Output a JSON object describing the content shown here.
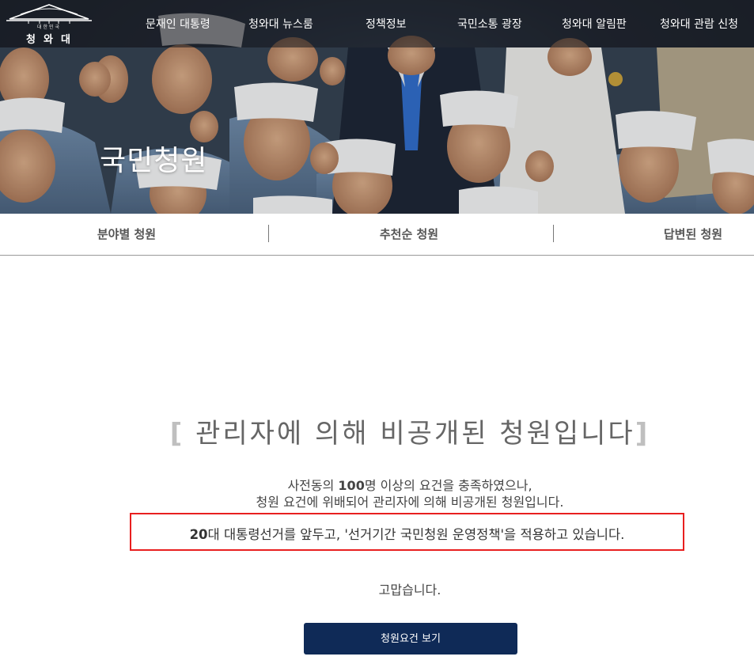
{
  "site": {
    "logo_small_text": "대한민국",
    "logo_main_text": "청와대"
  },
  "nav": {
    "items": [
      {
        "label": "문재인 대통령"
      },
      {
        "label": "청와대 뉴스룸"
      },
      {
        "label": "정책정보"
      },
      {
        "label": "국민소통 광장"
      },
      {
        "label": "청와대 알림판"
      },
      {
        "label": "청와대 관람 신청"
      }
    ]
  },
  "hero": {
    "title": "국민청원"
  },
  "tabs": [
    {
      "label": "분야별 청원"
    },
    {
      "label": "추천순 청원"
    },
    {
      "label": "답변된 청원"
    }
  ],
  "notice": {
    "bracket_open": "[",
    "heading": " 관리자에 의해 비공개된 청원입니다",
    "bracket_close": "]",
    "line1_prefix": "사전동의 ",
    "line1_number": "100",
    "line1_suffix": "명 이상의 요건을 충족하였으나,",
    "line2": "청원 요건에 위배되어 관리자에 의해 비공개된 청원입니다.",
    "highlight_number": "20",
    "highlight_text": "대 대통령선거를 앞두고, '선거기간 국민청원 운영정책'을 적용하고 있습니다.",
    "thanks": "고맙습니다.",
    "button_label": "청원요건 보기"
  },
  "colors": {
    "button_bg": "#0f2a57",
    "highlight_border": "#e81f1f"
  }
}
